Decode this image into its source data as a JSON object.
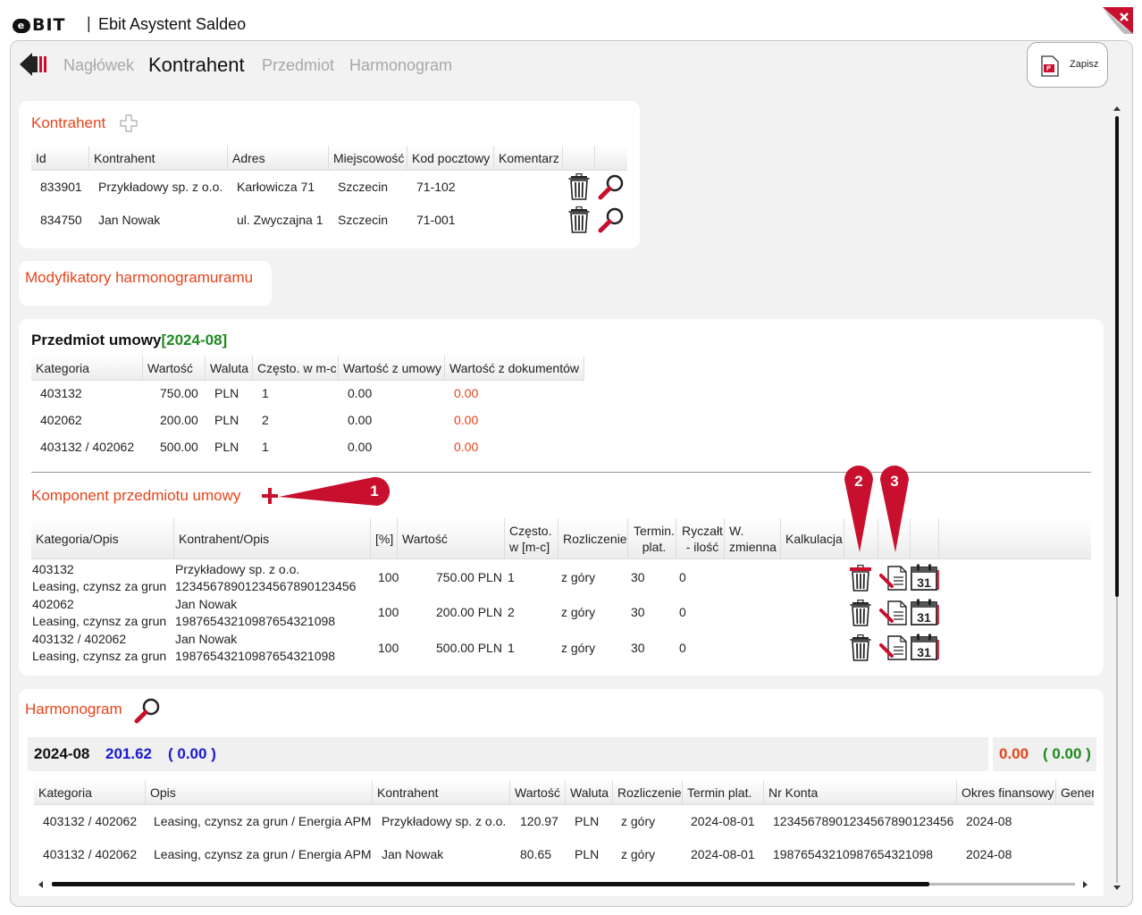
{
  "app": {
    "logo": "BIT",
    "logo_e": "e",
    "separator": "|",
    "title": "Ebit Asystent Saldeo"
  },
  "nav": {
    "tabs": [
      "Nagłówek",
      "Kontrahent",
      "Przedmiot",
      "Harmonogram"
    ],
    "active": "Kontrahent"
  },
  "save": {
    "label": "Zapisz"
  },
  "kontrahent": {
    "title": "Kontrahent",
    "columns": [
      "Id",
      "Kontrahent",
      "Adres",
      "Miejscowość",
      "Kod pocztowy",
      "Komentarz"
    ],
    "rows": [
      {
        "id": "833901",
        "name": "Przykładowy sp. z o.o.",
        "address": "Karłowicza 71",
        "city": "Szczecin",
        "zip": "71-102",
        "comment": ""
      },
      {
        "id": "834750",
        "name": "Jan Nowak",
        "address": "ul. Zwyczajna 1",
        "city": "Szczecin",
        "zip": "71-001",
        "comment": ""
      }
    ]
  },
  "modyfikatory": {
    "title": "Modyfikatory harmonogramuramu"
  },
  "przedmiot": {
    "title": "Przedmiot umowy",
    "period": "[2024-08]",
    "columns": [
      "Kategoria",
      "Wartość",
      "Waluta",
      "Często. w m-c",
      "Wartość z umowy",
      "Wartość z dokumentów"
    ],
    "rows": [
      {
        "cat": "403132",
        "val": "750.00",
        "cur": "PLN",
        "freq": "1",
        "contract": "0.00",
        "docs": "0.00"
      },
      {
        "cat": "402062",
        "val": "200.00",
        "cur": "PLN",
        "freq": "2",
        "contract": "0.00",
        "docs": "0.00"
      },
      {
        "cat": "403132 / 402062",
        "val": "500.00",
        "cur": "PLN",
        "freq": "1",
        "contract": "0.00",
        "docs": "0.00"
      }
    ]
  },
  "komponent": {
    "title": "Komponent przedmiotu umowy",
    "columns": {
      "cat": "Kategoria/Opis",
      "contr": "Kontrahent/Opis",
      "pct": "[%]",
      "val": "Wartość",
      "freq1": "Często.",
      "freq2": "w [m-c]",
      "settle": "Rozliczenie",
      "term1": "Termin.",
      "term2": "plat.",
      "lump1": "Ryczałt",
      "lump2": "- ilość",
      "var1": "W.",
      "var2": "zmienna",
      "calc": "Kalkulacja"
    },
    "rows": [
      {
        "cat": "403132",
        "desc": "Leasing, czynsz za grun /",
        "contr": "Przykładowy sp. z o.o.",
        "acct": "12345678901234567890123456",
        "pct": "100",
        "val": "750.00 PLN",
        "freq": "1",
        "settle": "z góry",
        "term": "30",
        "lump": "0"
      },
      {
        "cat": "402062",
        "desc": "Leasing, czynsz za grun /",
        "contr": "Jan Nowak",
        "acct": "19876543210987654321098",
        "pct": "100",
        "val": "200.00 PLN",
        "freq": "2",
        "settle": "z góry",
        "term": "30",
        "lump": "0"
      },
      {
        "cat": "403132 / 402062",
        "desc": "Leasing, czynsz za grun /",
        "contr": "Jan Nowak",
        "acct": "19876543210987654321098",
        "pct": "100",
        "val": "500.00 PLN",
        "freq": "1",
        "settle": "z góry",
        "term": "30",
        "lump": "0"
      }
    ],
    "calendar_day": "31"
  },
  "markers": [
    "1",
    "2",
    "3"
  ],
  "harmonogram": {
    "title": "Harmonogram",
    "summary": {
      "period": "2024-08",
      "total": "201.62",
      "paren": "( 0.00 )",
      "right_red": "0.00",
      "right_green": "( 0.00 )"
    },
    "columns": [
      "Kategoria",
      "Opis",
      "Kontrahent",
      "Wartość",
      "Waluta",
      "Rozliczenie",
      "Termin plat.",
      "Nr Konta",
      "Okres finansowy",
      "Gener"
    ],
    "rows": [
      {
        "cat": "403132 / 402062",
        "desc": "Leasing, czynsz za grun / Energia APM",
        "contr": "Przykładowy sp. z o.o.",
        "val": "120.97",
        "cur": "PLN",
        "settle": "z góry",
        "term": "2024-08-01",
        "acct": "12345678901234567890123456",
        "period": "2024-08"
      },
      {
        "cat": "403132 / 402062",
        "desc": "Leasing, czynsz za grun / Energia APM",
        "contr": "Jan Nowak",
        "val": "80.65",
        "cur": "PLN",
        "settle": "z góry",
        "term": "2024-08-01",
        "acct": "19876543210987654321098",
        "period": "2024-08"
      }
    ]
  },
  "colors": {
    "accent": "#e8441a",
    "marker": "#c8102e",
    "green": "#1e8a1e",
    "blue": "#1a1ad0"
  }
}
